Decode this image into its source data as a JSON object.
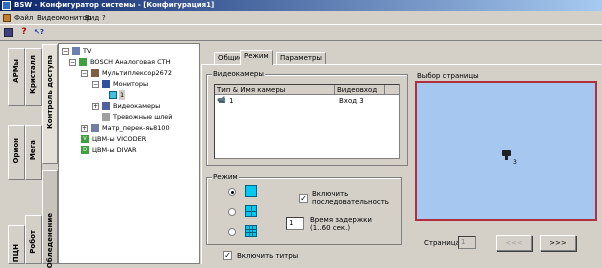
{
  "window": {
    "title": "BSW - Конфигуратор системы - [Конфигурация1]"
  },
  "menu": [
    "Файл",
    "Видеомонитор",
    "Вид",
    "?"
  ],
  "toolbar": {
    "save": "💾",
    "help": "?",
    "context_help": "↖?"
  },
  "vtabs": [
    "АРМы",
    "Кристалл",
    "Контроль доступа",
    "Орион",
    "Мега",
    "Робот",
    "Обледенение",
    "ПЦН"
  ],
  "tree": {
    "root": "TV",
    "device": "BOSCH Аналоговая СТН",
    "mux": "Мультиплексор2672",
    "monitors": "Мониторы",
    "monitor_1": "1",
    "cameras": "Видеокамеры",
    "alarm_loops": "Тревожные шлей",
    "matrix": "Матр_перек-яь8100",
    "vicoder": "ЦВМ-ы VICODER",
    "divar": "ЦВМ-ы DIVAR"
  },
  "tabs": [
    "Общие",
    "Режим",
    "Параметры"
  ],
  "cameras_group": {
    "title": "Видеокамеры",
    "columns": [
      "Тип & Имя камеры",
      "Видеовход"
    ],
    "rows": [
      {
        "name": "1",
        "input": "Вход 3"
      }
    ]
  },
  "mode_group": {
    "title": "Режим",
    "enable_sequence": "Включить последовательность",
    "delay_label": "Время задержки (1..60 сек.)",
    "delay_value": "1"
  },
  "enable_titles": "Включить титры",
  "page_select": {
    "title": "Выбор страницы",
    "camera_label": "3",
    "page_label": "Страница",
    "page_value": "1",
    "prev": "<<<",
    "next": ">>>"
  },
  "colors": {
    "preview_bg": "#a6c8f0",
    "preview_border": "#b03040",
    "title_start": "#0a246a"
  }
}
